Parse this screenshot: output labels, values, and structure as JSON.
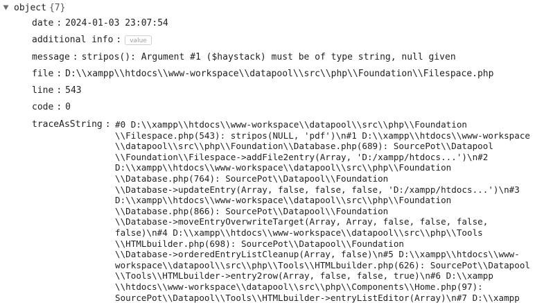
{
  "root": {
    "key": "object",
    "type": "{7}"
  },
  "properties": [
    {
      "key": "date",
      "value": "2024-01-03 23:07:54"
    },
    {
      "key": "additional info",
      "value": "",
      "placeholder": "value"
    },
    {
      "key": "message",
      "value": "stripos(): Argument #1 ($haystack) must be of type string, null given"
    },
    {
      "key": "file",
      "value": "D:\\\\xampp\\\\htdocs\\\\www-workspace\\\\datapool\\\\src\\\\php\\\\Foundation\\\\Filespace.php"
    },
    {
      "key": "line",
      "value": "543"
    },
    {
      "key": "code",
      "value": "0"
    }
  ],
  "trace": {
    "key": "traceAsString",
    "lines": [
      "#0 D:\\\\xampp\\\\htdocs\\\\www-workspace\\\\datapool\\\\src\\\\php\\\\Foundation",
      "\\\\Filespace.php(543): stripos(NULL, 'pdf')\\n#1 D:\\\\xampp\\\\htdocs\\\\www-workspace",
      "\\\\datapool\\\\src\\\\php\\\\Foundation\\\\Database.php(689): SourcePot\\\\Datapool",
      "\\\\Foundation\\\\Filespace->addFile2entry(Array, 'D:/xampp/htdocs...')\\n#2",
      "D:\\\\xampp\\\\htdocs\\\\www-workspace\\\\datapool\\\\src\\\\php\\\\Foundation",
      "\\\\Database.php(764): SourcePot\\\\Datapool\\\\Foundation",
      "\\\\Database->updateEntry(Array, false, false, false, 'D:/xampp/htdocs...')\\n#3",
      "D:\\\\xampp\\\\htdocs\\\\www-workspace\\\\datapool\\\\src\\\\php\\\\Foundation",
      "\\\\Database.php(866): SourcePot\\\\Datapool\\\\Foundation",
      "\\\\Database->moveEntryOverwriteTarget(Array, Array, false, false, false,",
      "false)\\n#4 D:\\\\xampp\\\\htdocs\\\\www-workspace\\\\datapool\\\\src\\\\php\\\\Tools",
      "\\\\HTMLbuilder.php(698): SourcePot\\\\Datapool\\\\Foundation",
      "\\\\Database->orderedEntryListCleanup(Array, false)\\n#5 D:\\\\xampp\\\\htdocs\\\\www-",
      "workspace\\\\datapool\\\\src\\\\php\\\\Tools\\\\HTMLbuilder.php(626): SourcePot\\\\Datapool",
      "\\\\Tools\\\\HTMLbuilder->entry2row(Array, false, false, true)\\n#6 D:\\\\xampp",
      "\\\\htdocs\\\\www-workspace\\\\datapool\\\\src\\\\php\\\\Components\\\\Home.php(97):",
      "SourcePot\\\\Datapool\\\\Tools\\\\HTMLbuilder->entryListEditor(Array)\\n#7 D:\\\\xampp"
    ]
  }
}
